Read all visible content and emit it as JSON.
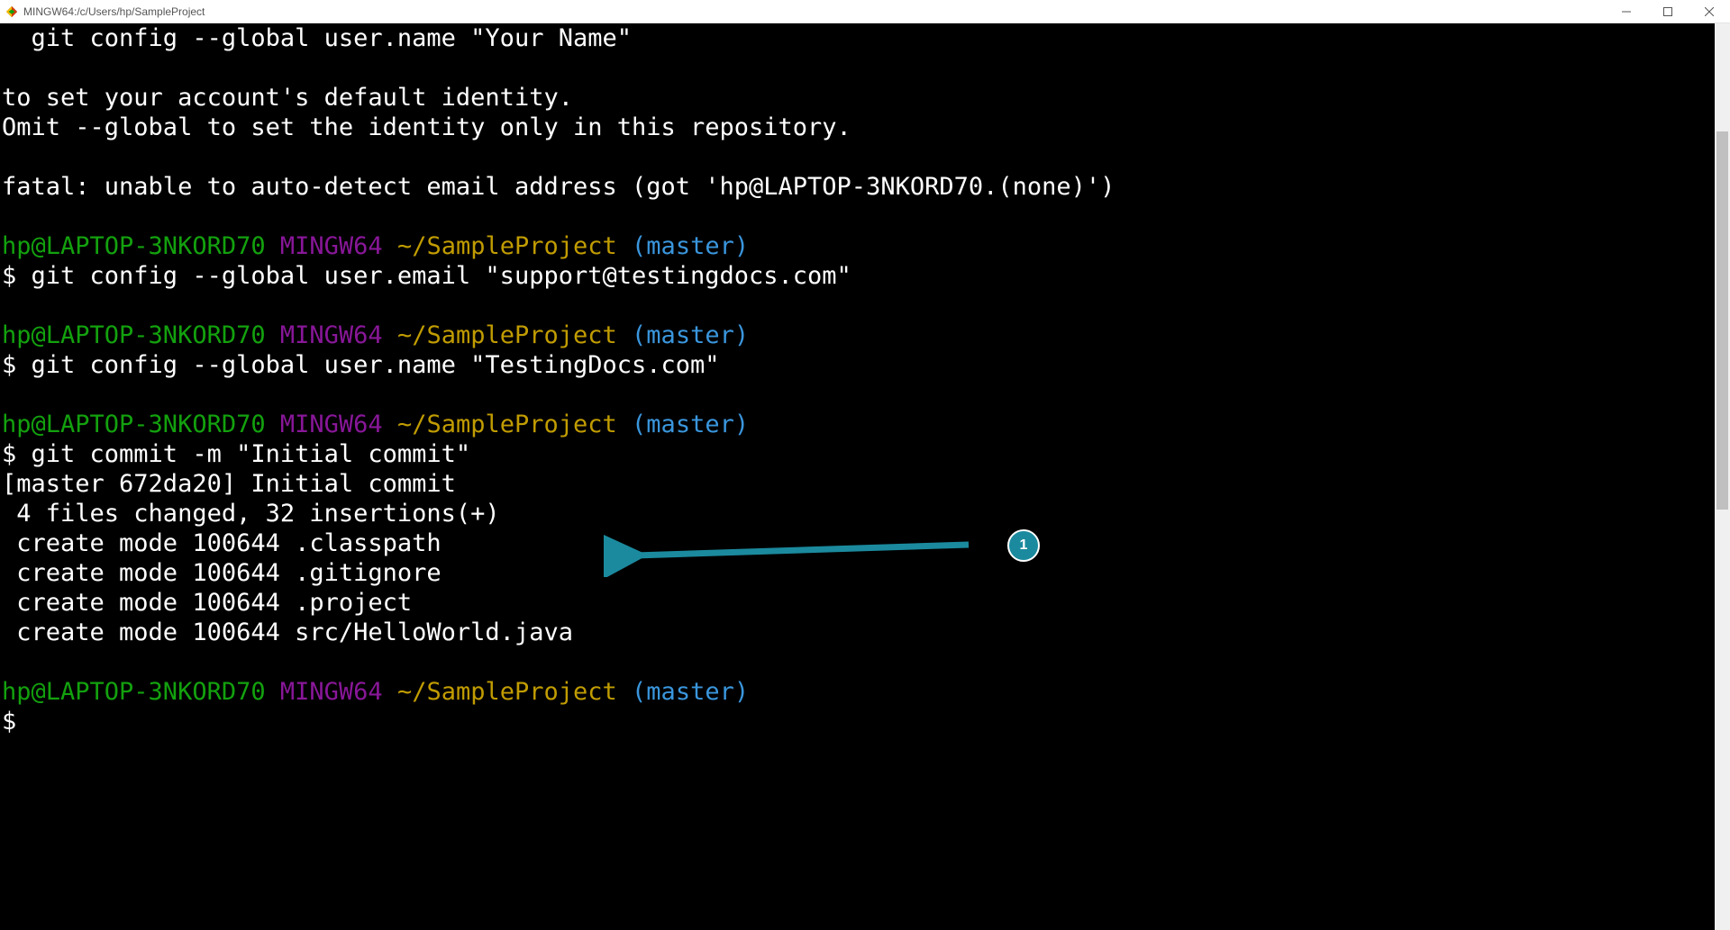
{
  "window": {
    "title": "MINGW64:/c/Users/hp/SampleProject"
  },
  "terminal": {
    "intro_lines": [
      "  git config --global user.name \"Your Name\"",
      "",
      "to set your account's default identity.",
      "Omit --global to set the identity only in this repository.",
      "",
      "fatal: unable to auto-detect email address (got 'hp@LAPTOP-3NKORD70.(none)')",
      ""
    ],
    "prompt": {
      "user_host": "hp@LAPTOP-3NKORD70",
      "env": "MINGW64",
      "path": "~/SampleProject",
      "branch": "(master)",
      "symbol": "$"
    },
    "blocks": [
      {
        "command": "git config --global user.email \"support@testingdocs.com\"",
        "output": []
      },
      {
        "command": "git config --global user.name \"TestingDocs.com\"",
        "output": []
      },
      {
        "command": "git commit -m \"Initial commit\"",
        "output": [
          "[master 672da20] Initial commit",
          " 4 files changed, 32 insertions(+)",
          " create mode 100644 .classpath",
          " create mode 100644 .gitignore",
          " create mode 100644 .project",
          " create mode 100644 src/HelloWorld.java"
        ]
      }
    ],
    "trailing_prompt_only": true
  },
  "annotation": {
    "number": "1"
  }
}
